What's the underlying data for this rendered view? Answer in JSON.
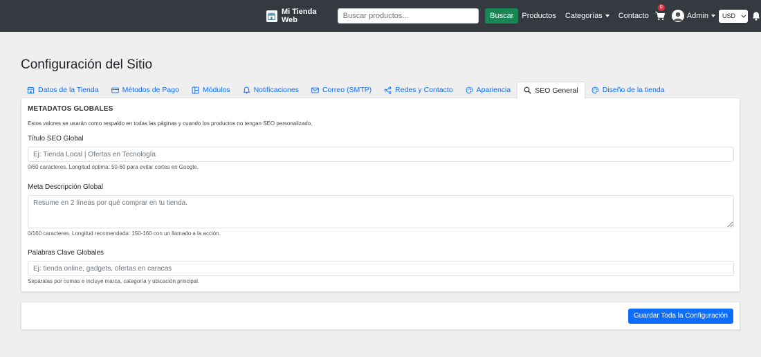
{
  "navbar": {
    "brand": "Mi Tienda Web",
    "search_placeholder": "Buscar productos...",
    "search_button": "Buscar",
    "links": {
      "productos": "Productos",
      "categorias": "Categorías",
      "contacto": "Contacto"
    },
    "cart_count": "0",
    "user": "Admin",
    "currency": "USD"
  },
  "page": {
    "title": "Configuración del Sitio"
  },
  "tabs": [
    {
      "label": "Datos de la Tienda",
      "icon": "store-icon"
    },
    {
      "label": "Métodos de Pago",
      "icon": "credit-card-icon"
    },
    {
      "label": "Módulos",
      "icon": "modules-icon"
    },
    {
      "label": "Notificaciones",
      "icon": "bell-icon"
    },
    {
      "label": "Correo (SMTP)",
      "icon": "envelope-icon"
    },
    {
      "label": "Redes y Contacto",
      "icon": "share-icon"
    },
    {
      "label": "Apariencia",
      "icon": "palette-icon"
    },
    {
      "label": "SEO General",
      "icon": "search-icon",
      "active": true
    },
    {
      "label": "Diseño de la tienda",
      "icon": "palette-icon"
    }
  ],
  "seo": {
    "section_title": "METADATOS GLOBALES",
    "section_desc": "Estos valores se usarán como respaldo en todas las páginas y cuando los productos no tengan SEO personalizado.",
    "title_label": "Título SEO Global",
    "title_placeholder": "Ej: Tienda Local | Ofertas en Tecnología",
    "title_help": "0/60 caracteres. Longitud óptima: 50-60 para evitar cortes en Google.",
    "desc_label": "Meta Descripción Global",
    "desc_placeholder": "Resume en 2 líneas por qué comprar en tu tienda.",
    "desc_help": "0/160 caracteres. Longitud recomendada: 150-160 con un llamado a la acción.",
    "keywords_label": "Palabras Clave Globales",
    "keywords_placeholder": "Ej: tienda online, gadgets, ofertas en caracas",
    "keywords_help": "Sepáralas por comas e incluye marca, categoría y ubicación principal."
  },
  "actions": {
    "save_button": "Guardar Toda la Configuración"
  },
  "colors": {
    "navbar": "#343a40",
    "accent": "#0d6efd",
    "success": "#198754",
    "badge": "#dc3545"
  }
}
